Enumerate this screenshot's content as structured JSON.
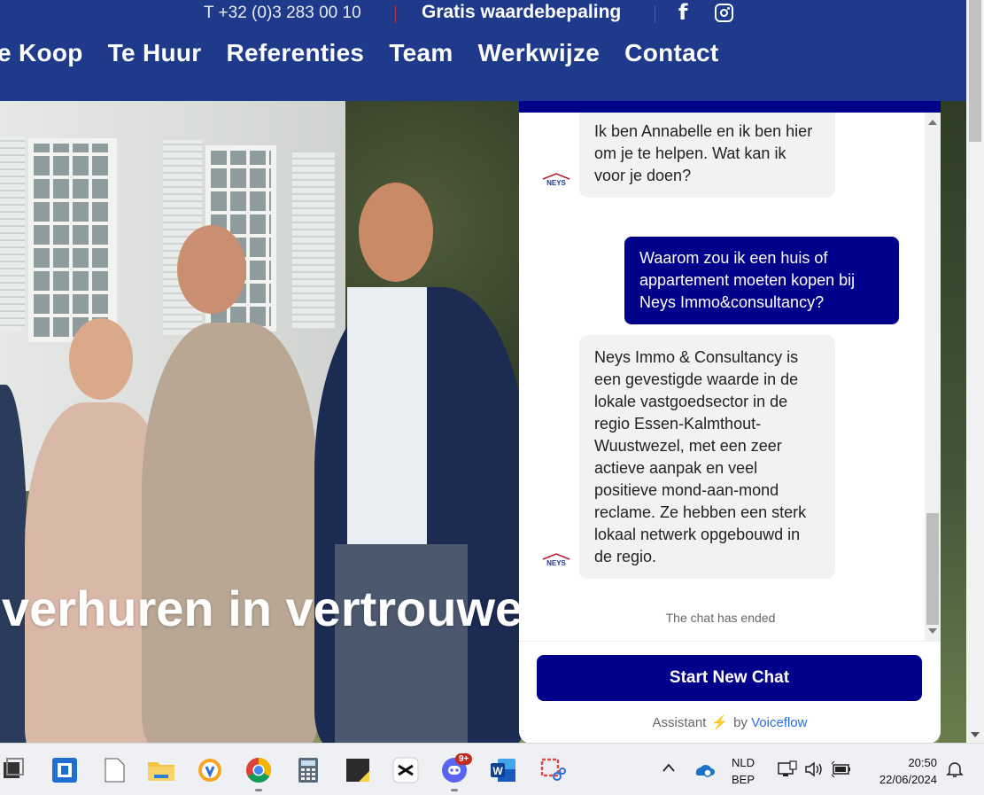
{
  "header": {
    "phone": "T +32 (0)3 283 00 10",
    "cta": "Gratis waardebepaling",
    "nav": [
      "e Koop",
      "Te Huur",
      "Referenties",
      "Team",
      "Werkwijze",
      "Contact"
    ]
  },
  "hero": {
    "headline": "verhuren in vertrouwe"
  },
  "chat": {
    "messages": [
      {
        "from": "bot",
        "text": "Ik ben Annabelle en ik ben hier om je te helpen. Wat kan ik voor je doen?"
      },
      {
        "from": "user",
        "text": "Waarom zou ik een huis of appartement moeten kopen bij Neys Immo&consultancy?"
      },
      {
        "from": "bot",
        "text": "Neys Immo & Consultancy is een gevestigde waarde in de lokale vastgoedsector in de regio Essen-Kalmthout-Wuustwezel, met een zeer actieve aanpak en veel positieve mond-aan-mond reclame. Ze hebben een sterk lokaal netwerk opgebouwd in de regio."
      }
    ],
    "avatar_text": "NEYS",
    "ended_text": "The chat has ended",
    "new_chat_label": "Start New Chat",
    "powered_prefix": "Assistant",
    "powered_by": "by",
    "powered_brand": "Voiceflow",
    "accent_color": "#00008b"
  },
  "taskbar": {
    "notification_badge": "9+",
    "language": "NLD",
    "keyboard": "BEP",
    "time": "20:50",
    "date": "22/06/2024",
    "apps": [
      "task-view",
      "screen-capture",
      "notepad",
      "file-explorer",
      "vpn-browser",
      "chrome",
      "calculator",
      "sticky-notes",
      "capcut",
      "discord",
      "word",
      "snipping-tool"
    ]
  },
  "colors": {
    "header_bg": "#1f3a8a",
    "chat_primary": "#00008b",
    "voiceflow_link": "#2d6fd8"
  }
}
